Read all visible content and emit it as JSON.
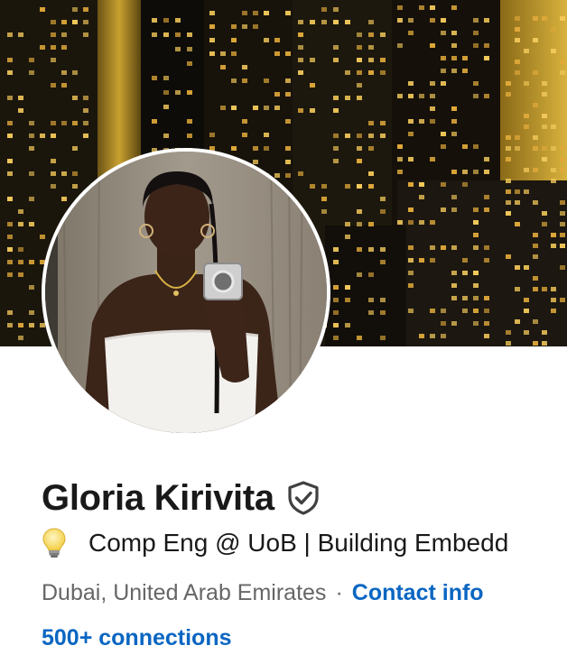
{
  "profile": {
    "name": "Gloria Kirivita",
    "headline": "Comp Eng @ UoB | Building Embedd",
    "location": "Dubai, United Arab Emirates",
    "separator": "·",
    "contact_label": "Contact info",
    "connections_label": "500+ connections"
  },
  "icons": {
    "verification": "shield-check-icon",
    "headline_emoji": "lightbulb-icon"
  },
  "colors": {
    "link": "#0a66c2",
    "text_primary": "#191919",
    "text_secondary": "#666666"
  }
}
